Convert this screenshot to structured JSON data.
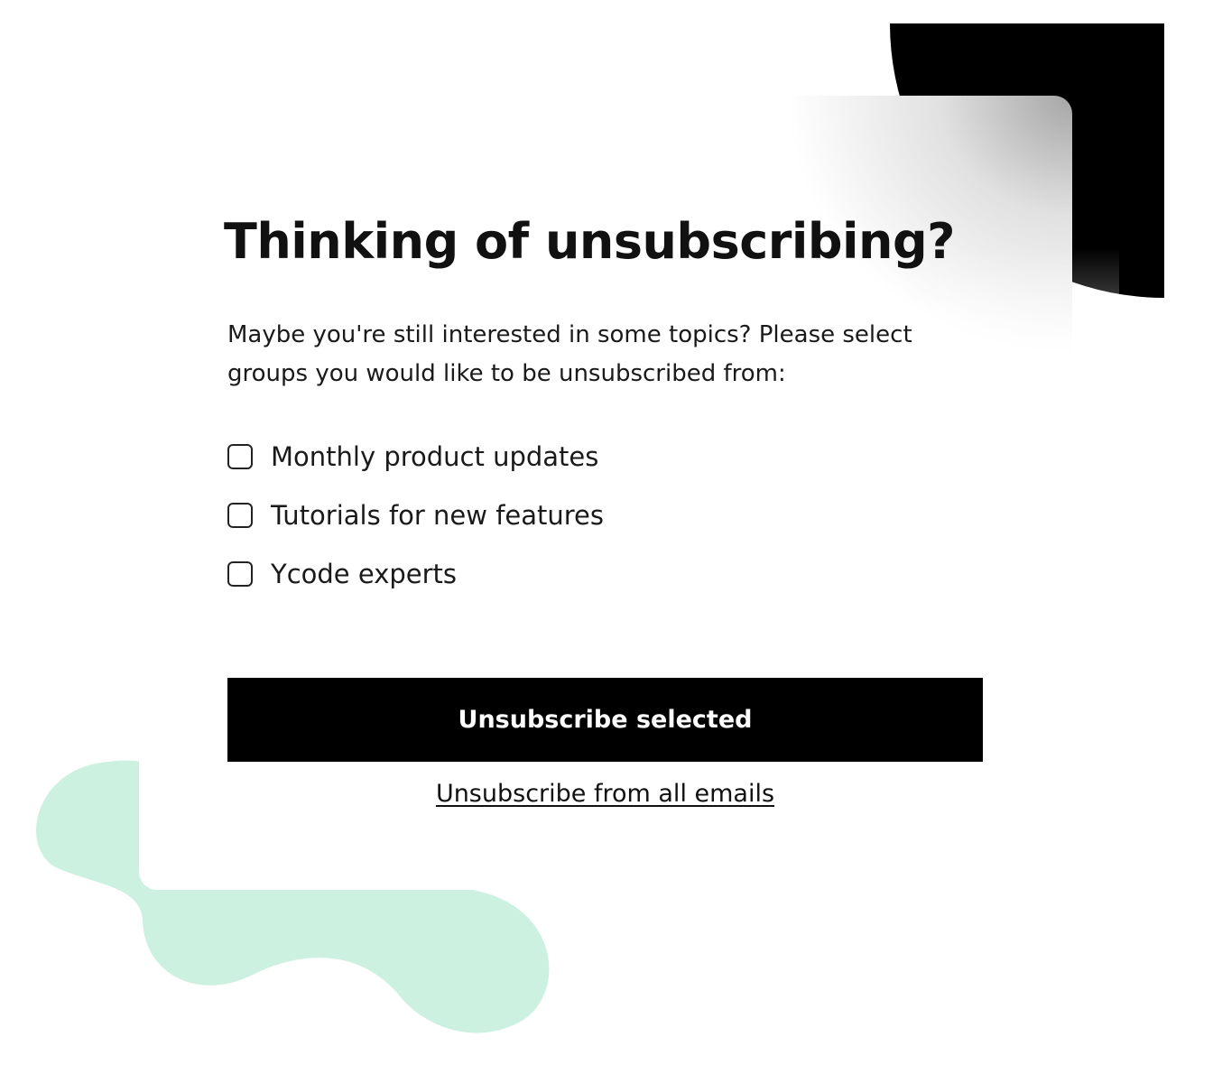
{
  "form": {
    "title": "Thinking of unsubscribing?",
    "description": "Maybe you're still interested in some topics? Please select groups you would like to be unsubscribed from:",
    "options": [
      {
        "label": "Monthly product updates",
        "checked": false
      },
      {
        "label": "Tutorials for new features",
        "checked": false
      },
      {
        "label": "Ycode experts",
        "checked": false
      }
    ],
    "primary_button_label": "Unsubscribe selected",
    "unsubscribe_all_link": "Unsubscribe from all emails"
  },
  "colors": {
    "button_background": "#000000",
    "button_text": "#ffffff",
    "accent_blob": "#cdf1e0",
    "accent_circle": "#000000"
  },
  "icons": {
    "checkbox": "empty-checkbox-icon"
  }
}
